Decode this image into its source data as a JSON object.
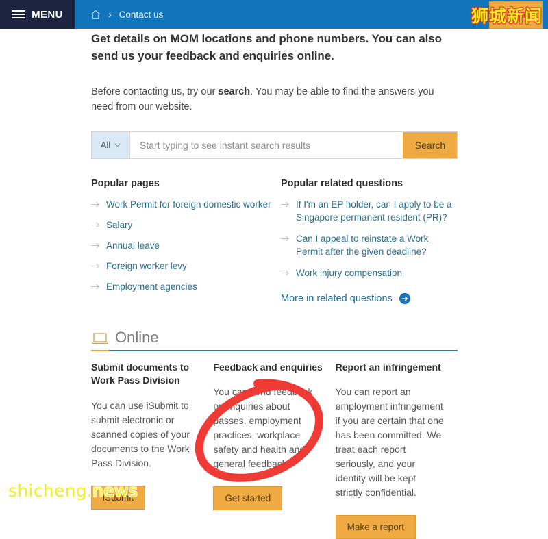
{
  "topbar": {
    "menu_label": "MENU",
    "home_icon": "home-icon",
    "breadcrumb_separator": "›",
    "breadcrumb_current": "Contact us",
    "search_button_label": "Search",
    "bar_color": "#1175bb",
    "menu_bg_color": "#1d2440",
    "search_button_color": "#f0aa44"
  },
  "main": {
    "lede": "Get details on MOM locations and phone numbers. You can also send us your feedback and enquiries online.",
    "subtext_before": "Before contacting us, try our ",
    "subtext_bold": "search",
    "subtext_after": ". You may be able to find the answers you need from our website."
  },
  "search": {
    "scope_label": "All",
    "placeholder": "Start typing to see instant search results",
    "value": "",
    "button_label": "Search",
    "scope_bg_color": "#dbe9f6"
  },
  "popular_pages": {
    "heading": "Popular pages",
    "items": [
      {
        "label": "Work Permit for foreign domestic worker"
      },
      {
        "label": "Salary"
      },
      {
        "label": "Annual leave"
      },
      {
        "label": "Foreign worker levy"
      },
      {
        "label": "Employment agencies"
      }
    ]
  },
  "popular_questions": {
    "heading": "Popular related questions",
    "items": [
      {
        "label": "If I'm an EP holder, can I apply to be a Singapore permanent resident (PR)?"
      },
      {
        "label": "Can I appeal to reinstate a Work Permit after the given deadline?"
      },
      {
        "label": "Work injury compensation"
      }
    ],
    "more_label": "More in related questions",
    "more_icon": "circle-arrow-right-icon"
  },
  "online_section": {
    "icon": "laptop-icon",
    "title": "Online",
    "rule_color": "#2e7d8f",
    "accent_color": "#e8a33d",
    "cards": [
      {
        "title": "Submit documents to Work Pass Division",
        "body": "You can use iSubmit to submit electronic or scanned copies of your documents to the Work Pass Division.",
        "cta": "iSubmit"
      },
      {
        "title": "Feedback and enquiries",
        "body": "You can send feedback or enquiries about passes, employment practices, workplace safety and health and general feedback.",
        "cta": "Get started"
      },
      {
        "title": "Report an infringement",
        "body": "You can report an employment infringement if you are certain that one has been committed. We treat each report seriously, and your identity will be kept strictly confidential.",
        "cta": "Make a report"
      }
    ]
  },
  "annotation": {
    "shape": "hand-drawn-red-ellipse",
    "color": "#ef3b36",
    "target": "Get started"
  },
  "watermarks": {
    "bottom_left": "shicheng.news",
    "top_right": "狮城新闻",
    "bottom_color": "#f5ec21",
    "top_color": "#f5ec21"
  }
}
